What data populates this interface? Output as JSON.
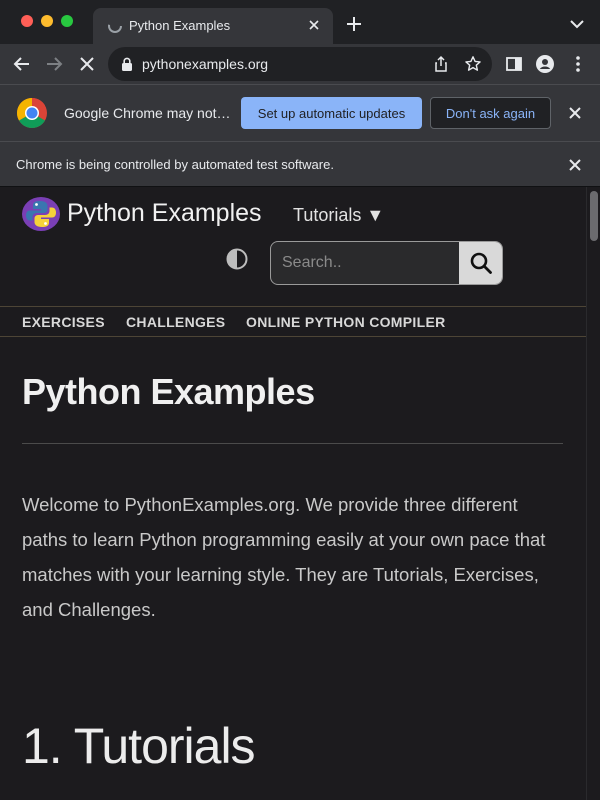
{
  "browser": {
    "tab_title": "Python Examples",
    "url": "pythonexamples.org",
    "update_bar": {
      "message": "Google Chrome may not…",
      "primary_button": "Set up automatic updates",
      "secondary_button": "Don't ask again"
    },
    "automation_bar": {
      "message": "Chrome is being controlled by automated test software."
    }
  },
  "site": {
    "title": "Python Examples",
    "tutorials_menu": "Tutorials ▼",
    "search_placeholder": "Search..",
    "nav": [
      "EXERCISES",
      "CHALLENGES",
      "ONLINE PYTHON COMPILER"
    ]
  },
  "content": {
    "heading": "Python Examples",
    "intro": "Welcome to PythonExamples.org. We provide three different paths to learn Python programming easily at your own pace that matches with your learning style. They are Tutorials, Exercises, and Challenges.",
    "section_heading": "1. Tutorials"
  },
  "colors": {
    "accent_blue": "#8ab4f8",
    "page_background": "#1c1b1e",
    "toolbar": "#35363a"
  },
  "icons": [
    "back-icon",
    "forward-icon",
    "stop-loading-icon",
    "lock-icon",
    "share-icon",
    "star-icon",
    "side-panel-icon",
    "profile-icon",
    "menu-icon",
    "chrome-logo-icon",
    "close-icon",
    "python-logo-icon",
    "contrast-icon",
    "search-icon"
  ]
}
